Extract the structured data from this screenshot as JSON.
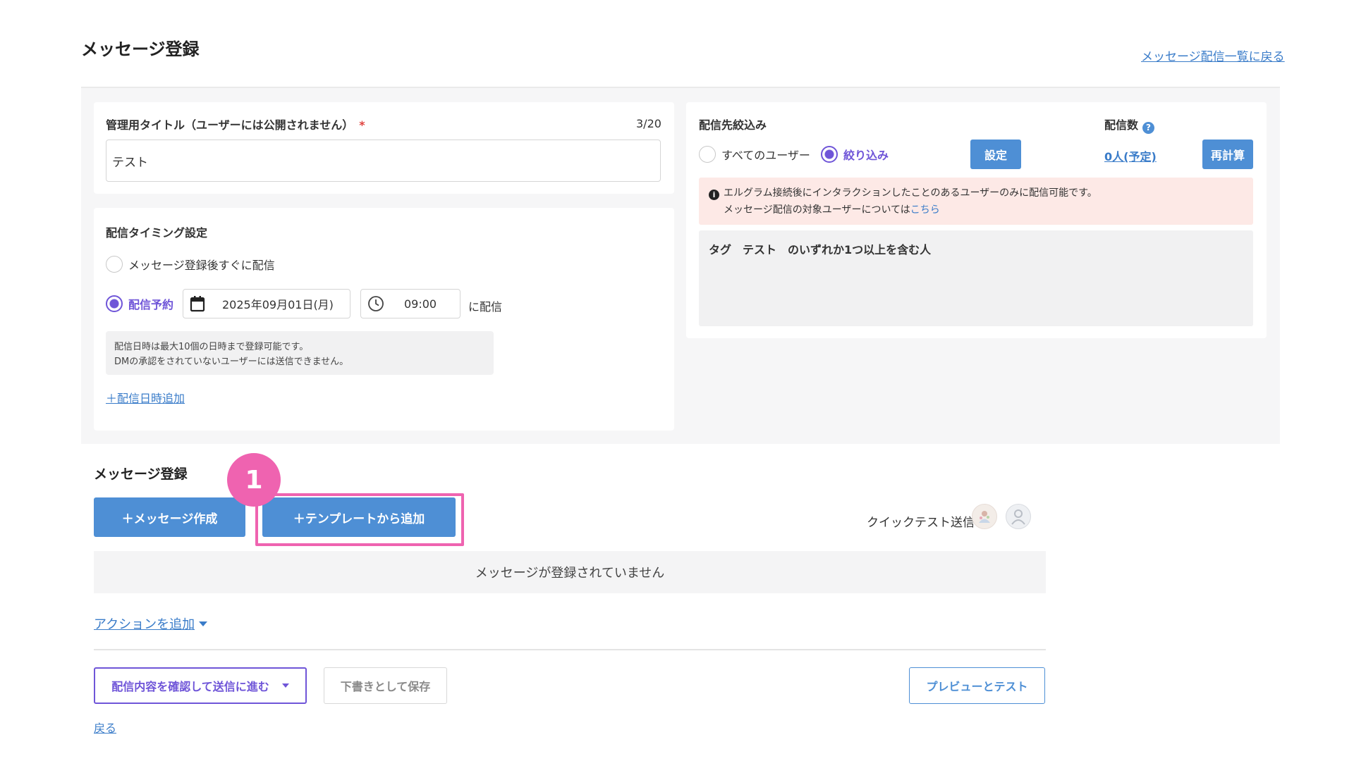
{
  "header": {
    "title": "メッセージ登録",
    "back_to_list": "メッセージ配信一覧に戻る"
  },
  "title_card": {
    "label": "管理用タイトル（ユーザーには公開されません）",
    "required_mark": "*",
    "counter": "3/20",
    "value": "テスト"
  },
  "timing": {
    "label": "配信タイミング設定",
    "option_immediate": "メッセージ登録後すぐに配信",
    "option_scheduled": "配信予約",
    "date": "2025年09月01日(月)",
    "time": "09:00",
    "suffix": "に配信",
    "note_line1": "配信日時は最大10個の日時まで登録可能です。",
    "note_line2": "DMの承認をされていないユーザーには送信できません。",
    "add_datetime": "＋配信日時追加"
  },
  "target": {
    "label": "配信先絞込み",
    "option_all": "すべてのユーザー",
    "option_filter": "絞り込み",
    "setting_button": "設定",
    "count_label": "配信数",
    "help_icon": "?",
    "count_value": "0人(予定)",
    "recalc_button": "再計算",
    "alert_line1": "エルグラム接続後にインタラクションしたことのあるユーザーのみに配信可能です。",
    "alert_line2_prefix": "メッセージ配信の対象ユーザーについては",
    "alert_link": "こちら",
    "condition": "タグ　テスト　のいずれか1つ以上を含む人"
  },
  "messages": {
    "title": "メッセージ登録",
    "badge_number": "1",
    "create_button": "＋メッセージ作成",
    "template_button": "＋テンプレートから追加",
    "quick_test": "クイックテスト送信",
    "empty_text": "メッセージが登録されていません",
    "add_action": "アクションを追加"
  },
  "footer": {
    "confirm_button": "配信内容を確認して送信に進む",
    "draft_button": "下書きとして保存",
    "preview_button": "プレビューとテスト",
    "back": "戻る"
  },
  "colors": {
    "accent_purple": "#6f55d8",
    "button_blue": "#4e8fd5",
    "link_blue": "#3a7cc9",
    "highlight_pink": "#ef63b0",
    "alert_bg": "#fde9e6"
  }
}
